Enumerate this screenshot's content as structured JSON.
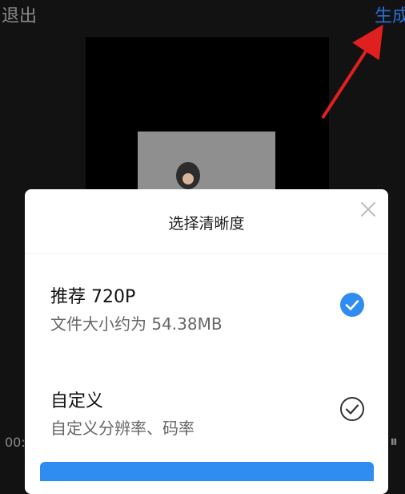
{
  "header": {
    "exit_label": "退出",
    "generate_label": "生成"
  },
  "player": {
    "time_text": "00:",
    "pause_glyph": "⏸"
  },
  "dialog": {
    "title": "选择清晰度",
    "options": [
      {
        "title": "推荐 720P",
        "subtitle": "文件大小约为 54.38MB",
        "selected": true
      },
      {
        "title": "自定义",
        "subtitle": "自定义分辨率、码率",
        "selected": false
      }
    ]
  },
  "colors": {
    "accent": "#2f8cf0",
    "annotation_arrow": "#e02020",
    "dim_text": "#8a8a8a"
  },
  "icons": [
    "close-icon",
    "check-filled-icon",
    "check-outline-icon",
    "pause-icon"
  ]
}
